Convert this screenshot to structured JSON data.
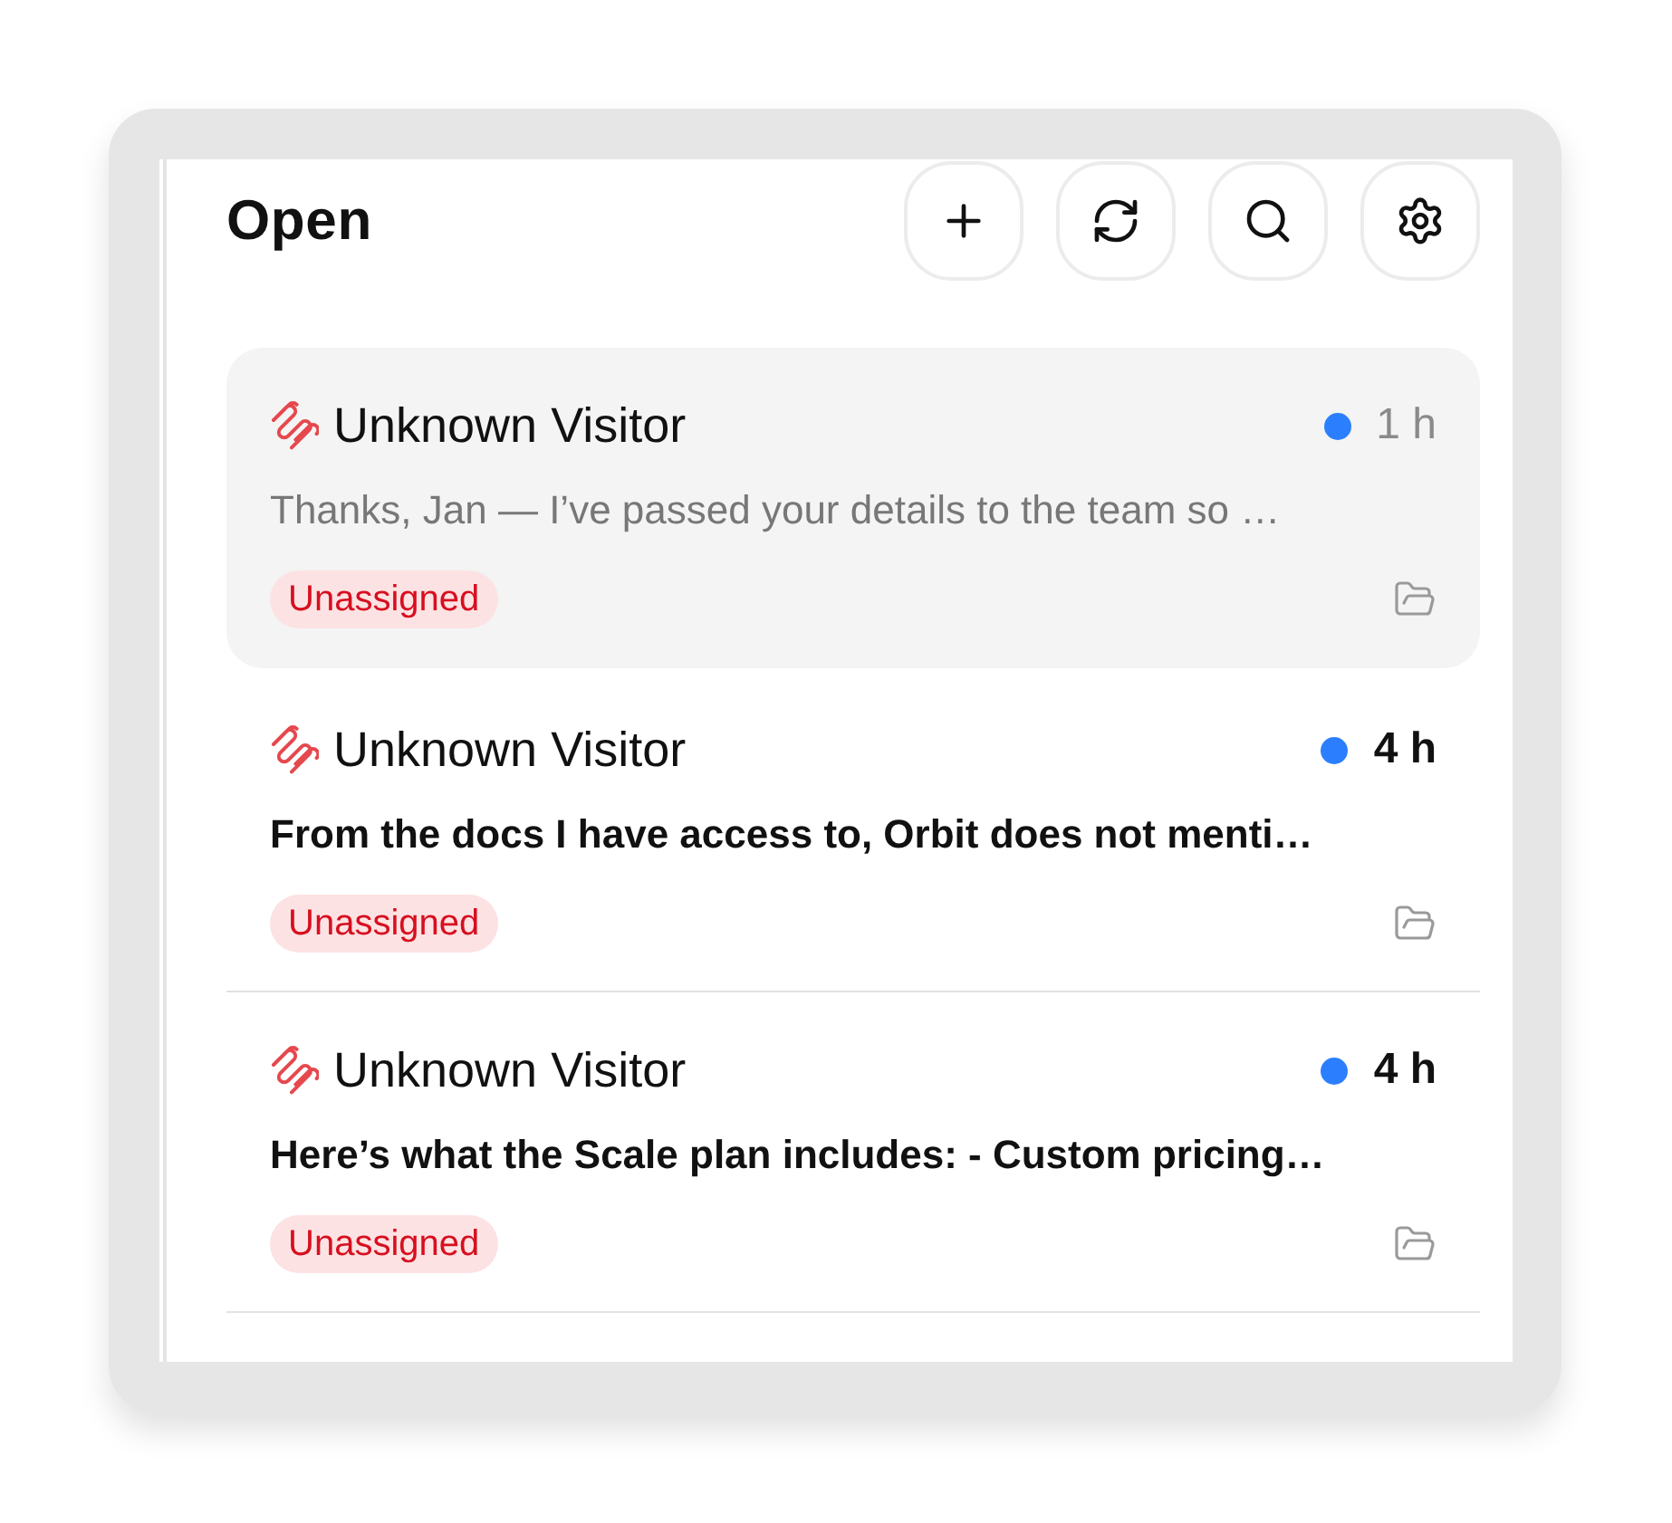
{
  "panel": {
    "title": "Open"
  },
  "conversations": [
    {
      "name": "Unknown Visitor",
      "status_dot": true,
      "time": "1 h",
      "preview": "Thanks, Jan — I’ve passed your details to the team so …",
      "tag": "Unassigned",
      "selected": true,
      "unread": false
    },
    {
      "name": "Unknown Visitor",
      "status_dot": true,
      "time": "4 h",
      "preview": "From the docs I have access to, Orbit does not menti…",
      "tag": "Unassigned",
      "selected": false,
      "unread": true
    },
    {
      "name": "Unknown Visitor",
      "status_dot": true,
      "time": "4 h",
      "preview": "Here’s what the Scale plan includes: - Custom pricing…",
      "tag": "Unassigned",
      "selected": false,
      "unread": true
    }
  ]
}
